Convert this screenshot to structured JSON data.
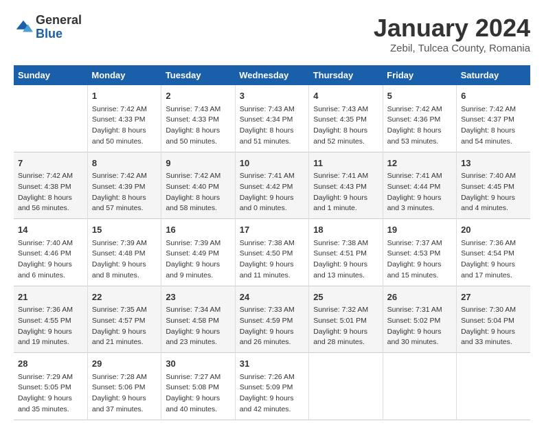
{
  "header": {
    "logo_general": "General",
    "logo_blue": "Blue",
    "title": "January 2024",
    "location": "Zebil, Tulcea County, Romania"
  },
  "columns": [
    "Sunday",
    "Monday",
    "Tuesday",
    "Wednesday",
    "Thursday",
    "Friday",
    "Saturday"
  ],
  "weeks": [
    [
      {
        "day": "",
        "sunrise": "",
        "sunset": "",
        "daylight": ""
      },
      {
        "day": "1",
        "sunrise": "Sunrise: 7:42 AM",
        "sunset": "Sunset: 4:33 PM",
        "daylight": "Daylight: 8 hours and 50 minutes."
      },
      {
        "day": "2",
        "sunrise": "Sunrise: 7:43 AM",
        "sunset": "Sunset: 4:33 PM",
        "daylight": "Daylight: 8 hours and 50 minutes."
      },
      {
        "day": "3",
        "sunrise": "Sunrise: 7:43 AM",
        "sunset": "Sunset: 4:34 PM",
        "daylight": "Daylight: 8 hours and 51 minutes."
      },
      {
        "day": "4",
        "sunrise": "Sunrise: 7:43 AM",
        "sunset": "Sunset: 4:35 PM",
        "daylight": "Daylight: 8 hours and 52 minutes."
      },
      {
        "day": "5",
        "sunrise": "Sunrise: 7:42 AM",
        "sunset": "Sunset: 4:36 PM",
        "daylight": "Daylight: 8 hours and 53 minutes."
      },
      {
        "day": "6",
        "sunrise": "Sunrise: 7:42 AM",
        "sunset": "Sunset: 4:37 PM",
        "daylight": "Daylight: 8 hours and 54 minutes."
      }
    ],
    [
      {
        "day": "7",
        "sunrise": "Sunrise: 7:42 AM",
        "sunset": "Sunset: 4:38 PM",
        "daylight": "Daylight: 8 hours and 56 minutes."
      },
      {
        "day": "8",
        "sunrise": "Sunrise: 7:42 AM",
        "sunset": "Sunset: 4:39 PM",
        "daylight": "Daylight: 8 hours and 57 minutes."
      },
      {
        "day": "9",
        "sunrise": "Sunrise: 7:42 AM",
        "sunset": "Sunset: 4:40 PM",
        "daylight": "Daylight: 8 hours and 58 minutes."
      },
      {
        "day": "10",
        "sunrise": "Sunrise: 7:41 AM",
        "sunset": "Sunset: 4:42 PM",
        "daylight": "Daylight: 9 hours and 0 minutes."
      },
      {
        "day": "11",
        "sunrise": "Sunrise: 7:41 AM",
        "sunset": "Sunset: 4:43 PM",
        "daylight": "Daylight: 9 hours and 1 minute."
      },
      {
        "day": "12",
        "sunrise": "Sunrise: 7:41 AM",
        "sunset": "Sunset: 4:44 PM",
        "daylight": "Daylight: 9 hours and 3 minutes."
      },
      {
        "day": "13",
        "sunrise": "Sunrise: 7:40 AM",
        "sunset": "Sunset: 4:45 PM",
        "daylight": "Daylight: 9 hours and 4 minutes."
      }
    ],
    [
      {
        "day": "14",
        "sunrise": "Sunrise: 7:40 AM",
        "sunset": "Sunset: 4:46 PM",
        "daylight": "Daylight: 9 hours and 6 minutes."
      },
      {
        "day": "15",
        "sunrise": "Sunrise: 7:39 AM",
        "sunset": "Sunset: 4:48 PM",
        "daylight": "Daylight: 9 hours and 8 minutes."
      },
      {
        "day": "16",
        "sunrise": "Sunrise: 7:39 AM",
        "sunset": "Sunset: 4:49 PM",
        "daylight": "Daylight: 9 hours and 9 minutes."
      },
      {
        "day": "17",
        "sunrise": "Sunrise: 7:38 AM",
        "sunset": "Sunset: 4:50 PM",
        "daylight": "Daylight: 9 hours and 11 minutes."
      },
      {
        "day": "18",
        "sunrise": "Sunrise: 7:38 AM",
        "sunset": "Sunset: 4:51 PM",
        "daylight": "Daylight: 9 hours and 13 minutes."
      },
      {
        "day": "19",
        "sunrise": "Sunrise: 7:37 AM",
        "sunset": "Sunset: 4:53 PM",
        "daylight": "Daylight: 9 hours and 15 minutes."
      },
      {
        "day": "20",
        "sunrise": "Sunrise: 7:36 AM",
        "sunset": "Sunset: 4:54 PM",
        "daylight": "Daylight: 9 hours and 17 minutes."
      }
    ],
    [
      {
        "day": "21",
        "sunrise": "Sunrise: 7:36 AM",
        "sunset": "Sunset: 4:55 PM",
        "daylight": "Daylight: 9 hours and 19 minutes."
      },
      {
        "day": "22",
        "sunrise": "Sunrise: 7:35 AM",
        "sunset": "Sunset: 4:57 PM",
        "daylight": "Daylight: 9 hours and 21 minutes."
      },
      {
        "day": "23",
        "sunrise": "Sunrise: 7:34 AM",
        "sunset": "Sunset: 4:58 PM",
        "daylight": "Daylight: 9 hours and 23 minutes."
      },
      {
        "day": "24",
        "sunrise": "Sunrise: 7:33 AM",
        "sunset": "Sunset: 4:59 PM",
        "daylight": "Daylight: 9 hours and 26 minutes."
      },
      {
        "day": "25",
        "sunrise": "Sunrise: 7:32 AM",
        "sunset": "Sunset: 5:01 PM",
        "daylight": "Daylight: 9 hours and 28 minutes."
      },
      {
        "day": "26",
        "sunrise": "Sunrise: 7:31 AM",
        "sunset": "Sunset: 5:02 PM",
        "daylight": "Daylight: 9 hours and 30 minutes."
      },
      {
        "day": "27",
        "sunrise": "Sunrise: 7:30 AM",
        "sunset": "Sunset: 5:04 PM",
        "daylight": "Daylight: 9 hours and 33 minutes."
      }
    ],
    [
      {
        "day": "28",
        "sunrise": "Sunrise: 7:29 AM",
        "sunset": "Sunset: 5:05 PM",
        "daylight": "Daylight: 9 hours and 35 minutes."
      },
      {
        "day": "29",
        "sunrise": "Sunrise: 7:28 AM",
        "sunset": "Sunset: 5:06 PM",
        "daylight": "Daylight: 9 hours and 37 minutes."
      },
      {
        "day": "30",
        "sunrise": "Sunrise: 7:27 AM",
        "sunset": "Sunset: 5:08 PM",
        "daylight": "Daylight: 9 hours and 40 minutes."
      },
      {
        "day": "31",
        "sunrise": "Sunrise: 7:26 AM",
        "sunset": "Sunset: 5:09 PM",
        "daylight": "Daylight: 9 hours and 42 minutes."
      },
      {
        "day": "",
        "sunrise": "",
        "sunset": "",
        "daylight": ""
      },
      {
        "day": "",
        "sunrise": "",
        "sunset": "",
        "daylight": ""
      },
      {
        "day": "",
        "sunrise": "",
        "sunset": "",
        "daylight": ""
      }
    ]
  ]
}
